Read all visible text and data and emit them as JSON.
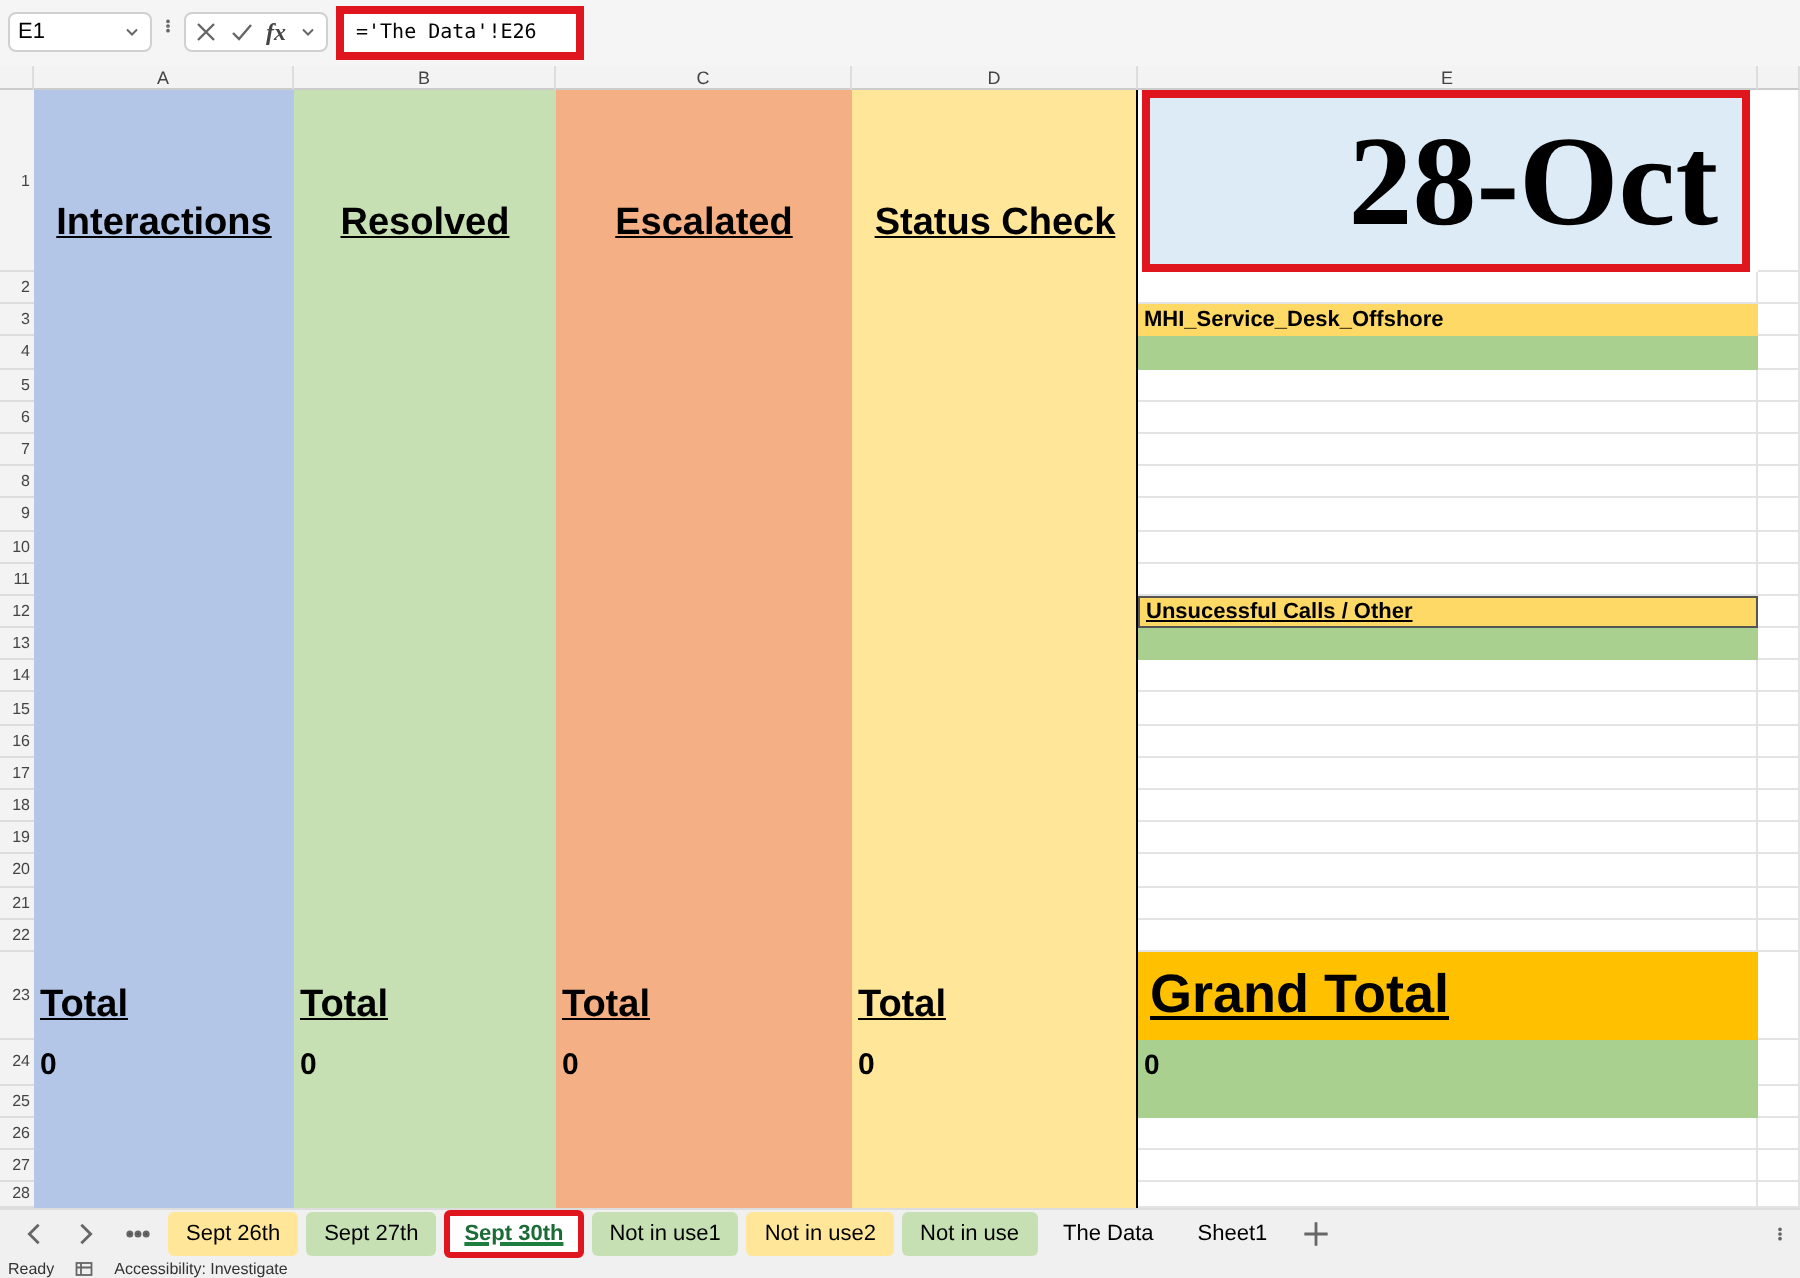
{
  "formula_bar": {
    "name_box": "E1",
    "function_label": "fx",
    "formula": "='The Data'!E26",
    "highlighted": true
  },
  "column_headers": [
    "A",
    "B",
    "C",
    "D",
    "E"
  ],
  "row_numbers": [
    "1",
    "2",
    "3",
    "4",
    "5",
    "6",
    "7",
    "8",
    "9",
    "10",
    "11",
    "12",
    "13",
    "14",
    "15",
    "16",
    "17",
    "18",
    "19",
    "20",
    "21",
    "22",
    "23",
    "24",
    "25",
    "26",
    "27",
    "28"
  ],
  "columns": [
    {
      "header": "Interactions",
      "color": "#b4c6e7",
      "total_label": "Total",
      "total": "0"
    },
    {
      "header": "Resolved",
      "color": "#c6e0b4",
      "total_label": "Total",
      "total": "0"
    },
    {
      "header": "Escalated",
      "color": "#f4b084",
      "total_label": "Total",
      "total": "0"
    },
    {
      "header": "Status Check",
      "color": "#ffe699",
      "total_label": "Total",
      "total": "0"
    }
  ],
  "summary": {
    "date": "28-Oct",
    "highlighted": true,
    "sections": [
      {
        "title": "MHI_Service_Desk_Offshore",
        "underline": false
      },
      {
        "title": "Unsucessful Calls / Other",
        "underline": true
      }
    ],
    "grand_total_label": "Grand Total",
    "grand_total": "0"
  },
  "sheet_tabs": [
    {
      "label": "Sept 26th",
      "color": "#ffe699",
      "selected": false,
      "highlighted": false
    },
    {
      "label": "Sept 27th",
      "color": "#c6e0b4",
      "selected": false,
      "highlighted": false
    },
    {
      "label": "Sept 30th",
      "selected": true,
      "highlighted": true
    },
    {
      "label": "Not in use1",
      "color": "#c6e0b4",
      "selected": false,
      "highlighted": false
    },
    {
      "label": "Not in use2",
      "color": "#ffe699",
      "selected": false,
      "highlighted": false
    },
    {
      "label": "Not in use",
      "color": "#c6e0b4",
      "selected": false,
      "highlighted": false
    },
    {
      "label": "The Data",
      "selected": false,
      "highlighted": false
    },
    {
      "label": "Sheet1",
      "selected": false,
      "highlighted": false
    }
  ],
  "status_bar": {
    "status": "Ready",
    "accessibility": "Accessibility: Investigate"
  }
}
